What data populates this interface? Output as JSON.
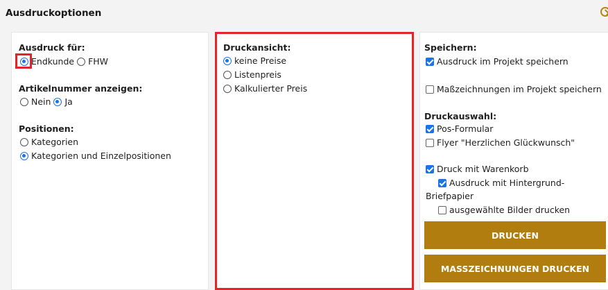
{
  "title": "Ausdruckoptionen",
  "colors": {
    "accent": "#b07d0e",
    "highlight": "#e3242b",
    "checked": "#1a73e8"
  },
  "left": {
    "ausdruck_fuer": {
      "label": "Ausdruck für:",
      "options": [
        "Endkunde",
        "FHW"
      ],
      "selected": "Endkunde"
    },
    "artikelnummer": {
      "label": "Artikelnummer anzeigen:",
      "options": [
        "Nein",
        "Ja"
      ],
      "selected": "Ja"
    },
    "positionen": {
      "label": "Positionen:",
      "options": [
        "Kategorien",
        "Kategorien und Einzelpositionen"
      ],
      "selected": "Kategorien und Einzelpositionen"
    }
  },
  "middle": {
    "druckansicht": {
      "label": "Druckansicht:",
      "options": [
        "keine Preise",
        "Listenpreis",
        "Kalkulierter Preis"
      ],
      "selected": "keine Preise"
    }
  },
  "right": {
    "speichern": {
      "label": "Speichern:",
      "items": [
        {
          "label": "Ausdruck im Projekt speichern",
          "checked": true
        },
        {
          "label": "Maßzeichnungen im Projekt speichern",
          "checked": false
        }
      ]
    },
    "druckauswahl": {
      "label": "Druckauswahl:",
      "items": [
        {
          "label": "Pos-Formular",
          "checked": true
        },
        {
          "label": "Flyer \"Herzlichen Glückwunsch\"",
          "checked": false
        },
        {
          "label": "Druck mit Warenkorb",
          "checked": true
        },
        {
          "label": "Ausdruck mit Hintergrund-",
          "label2": "Briefpapier",
          "checked": true
        },
        {
          "label": "ausgewählte Bilder drucken",
          "checked": false
        }
      ]
    },
    "buttons": {
      "print": "DRUCKEN",
      "print_dimensions": "MASSZEICHNUNGEN DRUCKEN"
    }
  }
}
